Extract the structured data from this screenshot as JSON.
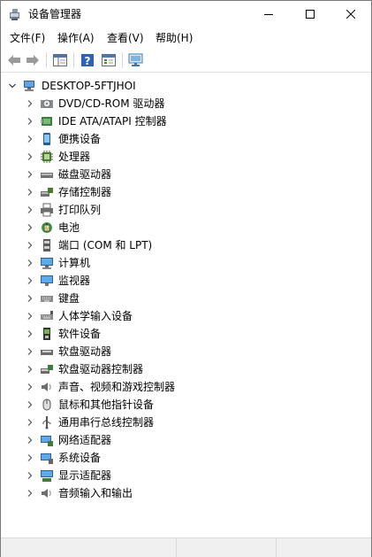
{
  "window": {
    "title": "设备管理器"
  },
  "menu": [
    {
      "label": "文件(F)"
    },
    {
      "label": "操作(A)"
    },
    {
      "label": "查看(V)"
    },
    {
      "label": "帮助(H)"
    }
  ],
  "tree": {
    "root": "DESKTOP-5FTJHOI",
    "items": [
      {
        "label": "DVD/CD-ROM 驱动器",
        "icon": "dvd-drive-icon"
      },
      {
        "label": "IDE ATA/ATAPI 控制器",
        "icon": "ide-controller-icon"
      },
      {
        "label": "便携设备",
        "icon": "portable-device-icon"
      },
      {
        "label": "处理器",
        "icon": "processor-icon"
      },
      {
        "label": "磁盘驱动器",
        "icon": "disk-drive-icon"
      },
      {
        "label": "存储控制器",
        "icon": "storage-controller-icon"
      },
      {
        "label": "打印队列",
        "icon": "printer-icon"
      },
      {
        "label": "电池",
        "icon": "battery-icon"
      },
      {
        "label": "端口 (COM 和 LPT)",
        "icon": "port-icon"
      },
      {
        "label": "计算机",
        "icon": "computer-icon"
      },
      {
        "label": "监视器",
        "icon": "monitor-icon"
      },
      {
        "label": "键盘",
        "icon": "keyboard-icon"
      },
      {
        "label": "人体学输入设备",
        "icon": "hid-icon"
      },
      {
        "label": "软件设备",
        "icon": "software-device-icon"
      },
      {
        "label": "软盘驱动器",
        "icon": "floppy-drive-icon"
      },
      {
        "label": "软盘驱动器控制器",
        "icon": "floppy-controller-icon"
      },
      {
        "label": "声音、视频和游戏控制器",
        "icon": "sound-icon"
      },
      {
        "label": "鼠标和其他指针设备",
        "icon": "mouse-icon"
      },
      {
        "label": "通用串行总线控制器",
        "icon": "usb-icon"
      },
      {
        "label": "网络适配器",
        "icon": "network-adapter-icon"
      },
      {
        "label": "系统设备",
        "icon": "system-device-icon"
      },
      {
        "label": "显示适配器",
        "icon": "display-adapter-icon"
      },
      {
        "label": "音频输入和输出",
        "icon": "audio-io-icon"
      }
    ]
  }
}
